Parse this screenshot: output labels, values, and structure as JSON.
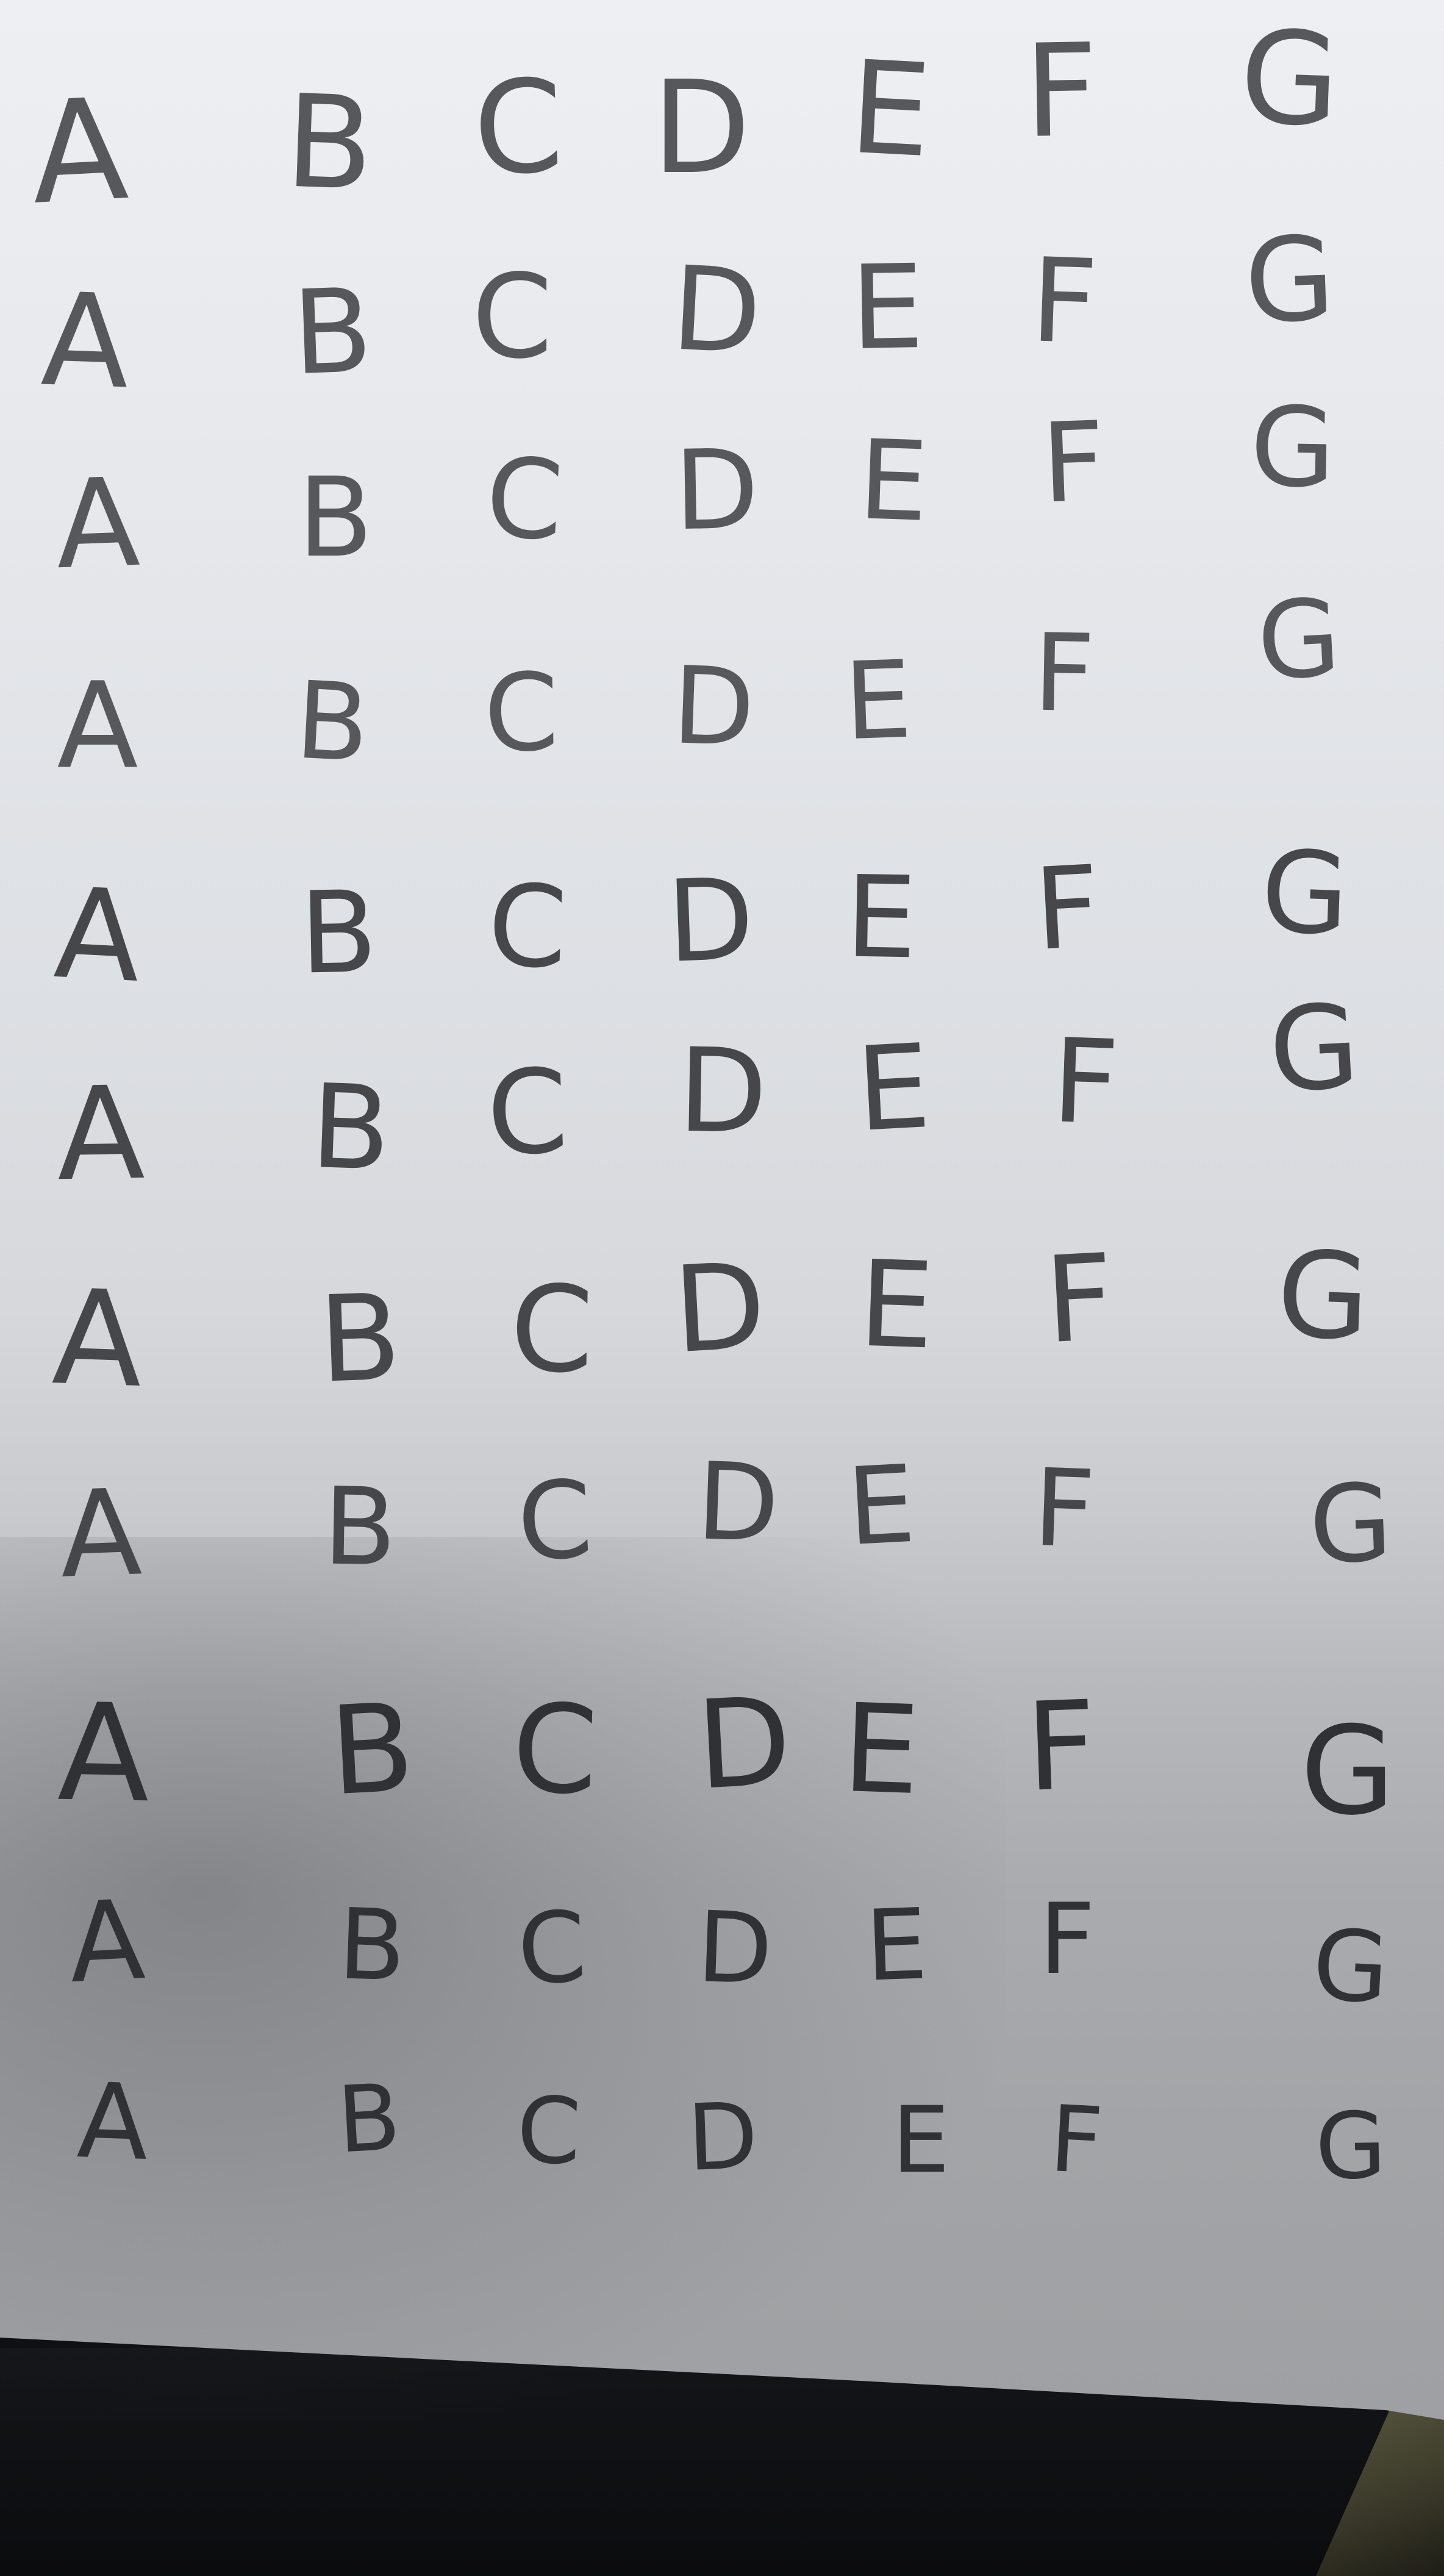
{
  "sheet": {
    "rows": [
      [
        "A",
        "B",
        "C",
        "D",
        "E",
        "F",
        "G"
      ],
      [
        "A",
        "B",
        "C",
        "D",
        "E",
        "F",
        "G"
      ],
      [
        "A",
        "B",
        "C",
        "D",
        "E",
        "F",
        "G"
      ],
      [
        "A",
        "B",
        "C",
        "D",
        "E",
        "F",
        "G"
      ],
      [
        "A",
        "B",
        "C",
        "D",
        "E",
        "F",
        "G"
      ],
      [
        "A",
        "B",
        "C",
        "D",
        "E",
        "F",
        "G"
      ],
      [
        "A",
        "B",
        "C",
        "D",
        "E",
        "F",
        "G"
      ],
      [
        "A",
        "B",
        "C",
        "D",
        "E",
        "F",
        "G"
      ],
      [
        "A",
        "B",
        "C",
        "D",
        "E",
        "F",
        "G"
      ],
      [
        "A",
        "B",
        "C",
        "D",
        "E",
        "F",
        "G"
      ],
      [
        "A",
        "B",
        "C",
        "D",
        "E",
        "F",
        "G"
      ]
    ]
  },
  "colors": {
    "paper": "#e6e8ec",
    "ink": "#3d3f43",
    "table": "#0d0e10"
  }
}
